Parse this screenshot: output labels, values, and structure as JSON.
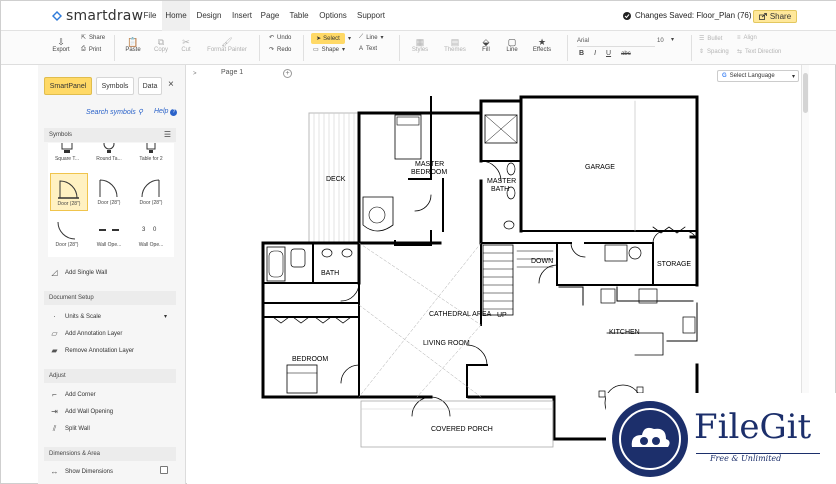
{
  "app": {
    "brand": "smartdraw",
    "menu": [
      "File",
      "Home",
      "Design",
      "Insert",
      "Page",
      "Table",
      "Options",
      "Support"
    ],
    "active_menu": "Home",
    "status": "Changes Saved: Floor_Plan (76)",
    "share_label": "Share"
  },
  "toolbar": {
    "export": "Export",
    "share": "Share",
    "print": "Print",
    "paste": "Paste",
    "copy": "Copy",
    "cut": "Cut",
    "format_painter": "Format Painter",
    "undo": "Undo",
    "redo": "Redo",
    "select": "Select",
    "shape": "Shape",
    "line_menu": "Line",
    "text": "Text",
    "styles": "Styles",
    "themes": "Themes",
    "fill": "Fill",
    "line": "Line",
    "effects": "Effects",
    "font": "Arial",
    "font_size": "10",
    "bold": "B",
    "italic": "I",
    "underline": "U",
    "strike": "abc",
    "bullet": "Bullet",
    "align": "Align",
    "spacing": "Spacing",
    "text_direction": "Text Direction"
  },
  "panel": {
    "tabs": [
      "SmartPanel",
      "Symbols",
      "Data"
    ],
    "close": "×",
    "search": "Search symbols",
    "help": "Help",
    "symbols_header": "Symbols",
    "symbols": [
      {
        "label": "Square T..."
      },
      {
        "label": "Round Ta..."
      },
      {
        "label": "Table for 2"
      },
      {
        "label": "Door (28\")"
      },
      {
        "label": "Door (28\")"
      },
      {
        "label": "Door (28\")"
      },
      {
        "label": "Door (28\")"
      },
      {
        "label": "Wall Ope..."
      },
      {
        "label": "Wall Ope..."
      }
    ],
    "add_single_wall": "Add Single Wall",
    "document_setup": "Document Setup",
    "units_scale": "Units & Scale",
    "add_annotation": "Add Annotation Layer",
    "remove_annotation": "Remove Annotation Layer",
    "adjust": "Adjust",
    "add_corner": "Add Corner",
    "add_wall_opening": "Add Wall Opening",
    "split_wall": "Split Wall",
    "dimensions_area": "Dimensions & Area",
    "show_dimensions": "Show Dimensions"
  },
  "canvas": {
    "page_tab": "Page 1",
    "language": "Select Language",
    "rooms": {
      "deck": "DECK",
      "master": "MASTER",
      "bedroom": "BEDROOM",
      "master_bath_1": "MASTER",
      "master_bath_2": "BATH",
      "garage": "GARAGE",
      "bath": "BATH",
      "down": "DOWN",
      "storage": "STORAGE",
      "cathedral": "CATHEDRAL AREA",
      "up": "UP",
      "kitchen": "KITCHEN",
      "bedroom2": "BEDROOM",
      "living": "LIVING ROOM",
      "porch": "COVERED PORCH"
    }
  },
  "watermark": {
    "title": "FileGit",
    "tagline": "Free & Unlimited"
  },
  "colors": {
    "accent": "#ffd966",
    "link": "#2a62c9",
    "watermark": "#1c2f6b"
  }
}
